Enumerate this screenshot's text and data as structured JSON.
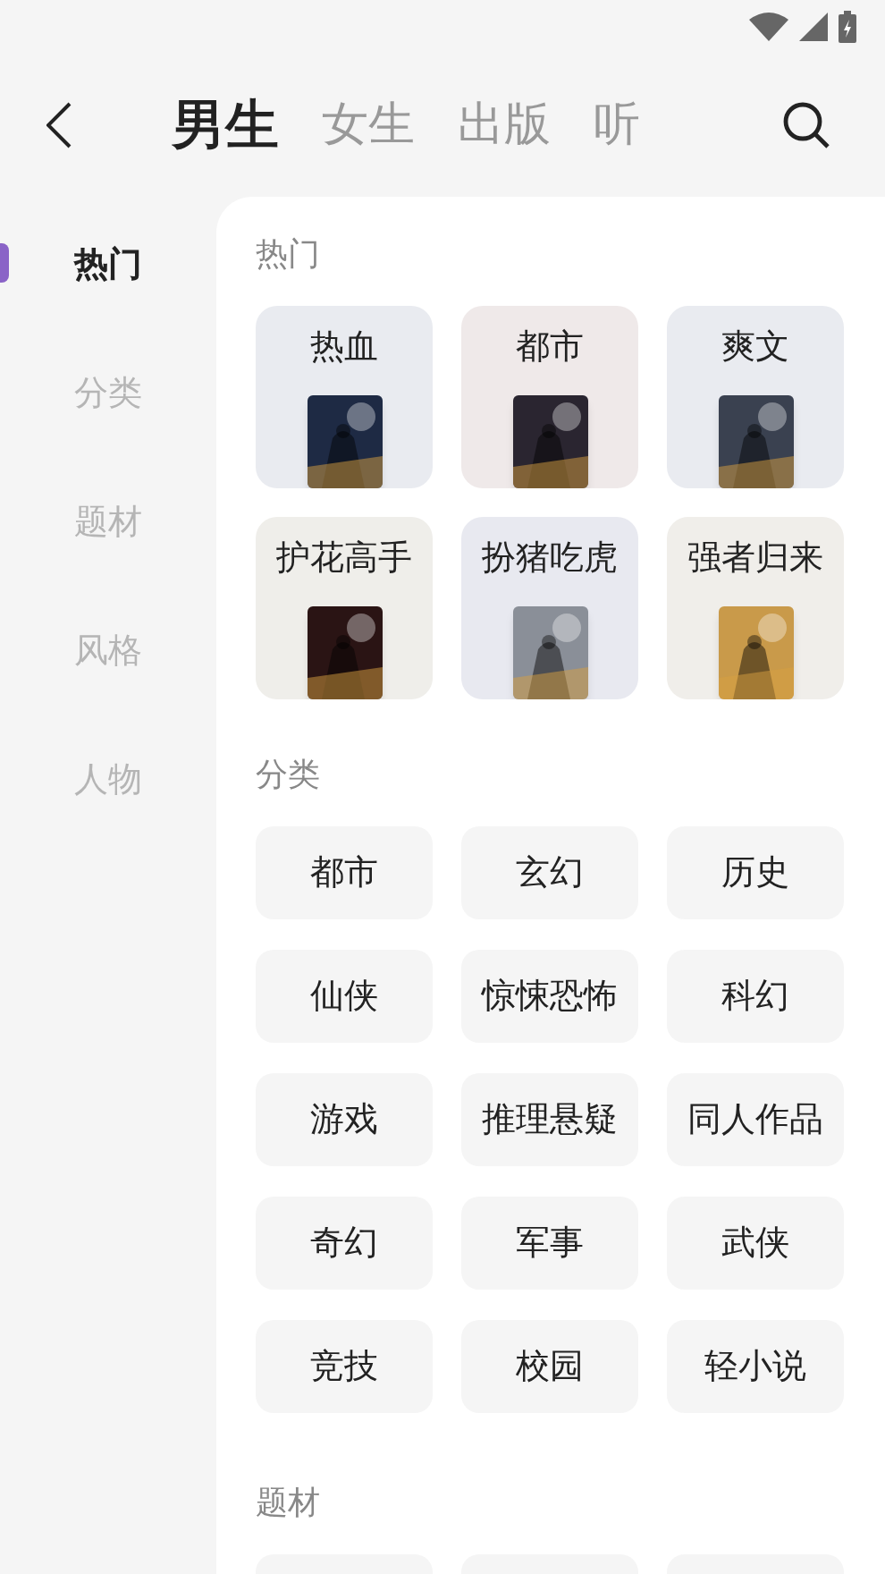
{
  "tabs": [
    {
      "label": "男生",
      "selected": true
    },
    {
      "label": "女生",
      "selected": false
    },
    {
      "label": "出版",
      "selected": false
    },
    {
      "label": "听",
      "selected": false
    }
  ],
  "sidebar": {
    "items": [
      {
        "label": "热门",
        "selected": true
      },
      {
        "label": "分类",
        "selected": false
      },
      {
        "label": "题材",
        "selected": false
      },
      {
        "label": "风格",
        "selected": false
      },
      {
        "label": "人物",
        "selected": false
      }
    ]
  },
  "sections": [
    {
      "title": "热门",
      "kind": "covers",
      "items": [
        {
          "label": "热血",
          "color": "#e9ebf0"
        },
        {
          "label": "都市",
          "color": "#efe9e9"
        },
        {
          "label": "爽文",
          "color": "#e9ebf0"
        },
        {
          "label": "护花高手",
          "color": "#efeeea"
        },
        {
          "label": "扮猪吃虎",
          "color": "#e8e9f0"
        },
        {
          "label": "强者归来",
          "color": "#f0eeea"
        }
      ]
    },
    {
      "title": "分类",
      "kind": "buttons",
      "items": [
        {
          "label": "都市"
        },
        {
          "label": "玄幻"
        },
        {
          "label": "历史"
        },
        {
          "label": "仙侠"
        },
        {
          "label": "惊悚恐怖"
        },
        {
          "label": "科幻"
        },
        {
          "label": "游戏"
        },
        {
          "label": "推理悬疑"
        },
        {
          "label": "同人作品"
        },
        {
          "label": "奇幻"
        },
        {
          "label": "军事"
        },
        {
          "label": "武侠"
        },
        {
          "label": "竞技"
        },
        {
          "label": "校园"
        },
        {
          "label": "轻小说"
        }
      ]
    },
    {
      "title": "题材",
      "kind": "cut",
      "items": [
        {
          "kind": "card"
        },
        {
          "kind": "card"
        },
        {
          "kind": "card"
        }
      ]
    }
  ]
}
